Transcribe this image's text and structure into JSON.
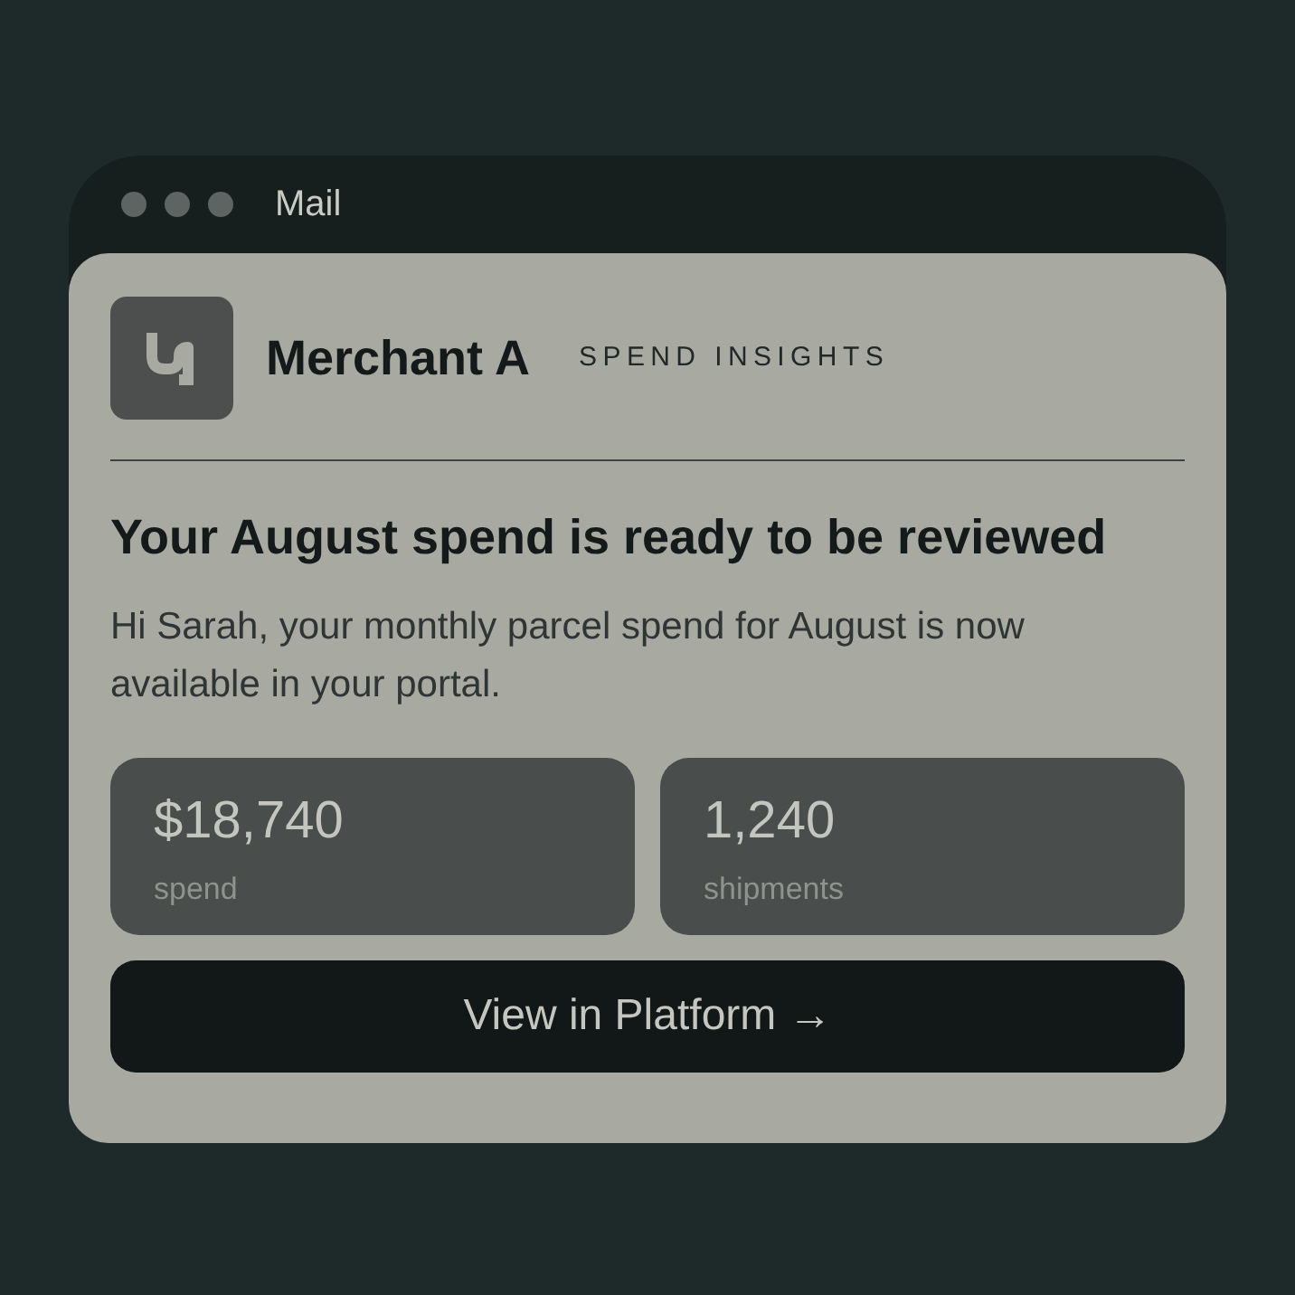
{
  "window": {
    "title": "Mail"
  },
  "email": {
    "brand": "Merchant A",
    "tag": "SPEND INSIGHTS",
    "heading": "Your August spend is ready to be reviewed",
    "body": "Hi Sarah, your monthly parcel spend for August is now available in your portal.",
    "stats": [
      {
        "value": "$18,740",
        "label": "spend"
      },
      {
        "value": "1,240",
        "label": "shipments"
      }
    ],
    "button": {
      "label": "View in Platform →"
    }
  }
}
